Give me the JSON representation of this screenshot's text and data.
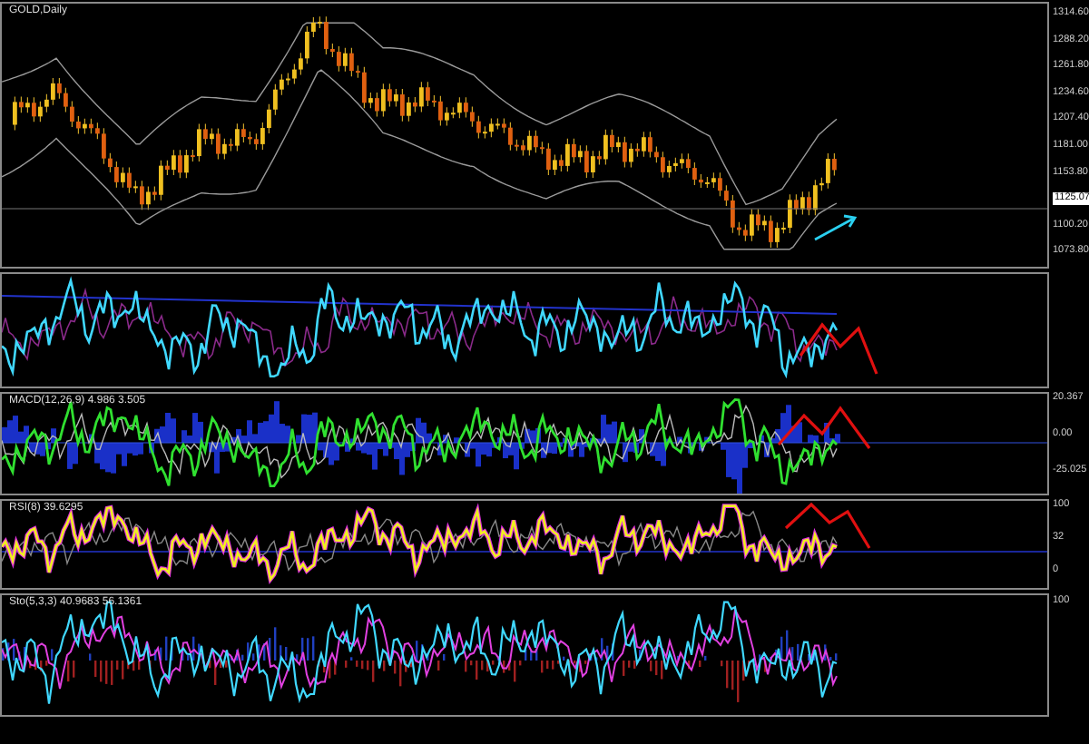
{
  "chart": {
    "title": "GOLD,Daily",
    "price_labels": [
      {
        "text": "1314.60",
        "current": false
      },
      {
        "text": "1288.20",
        "current": false
      },
      {
        "text": "1261.80",
        "current": false
      },
      {
        "text": "1234.60",
        "current": false
      },
      {
        "text": "1207.40",
        "current": false
      },
      {
        "text": "1181.00",
        "current": false
      },
      {
        "text": "1153.80",
        "current": false
      },
      {
        "text": "1125.07",
        "current": true
      },
      {
        "text": "1100.20",
        "current": false
      },
      {
        "text": "1073.80",
        "current": false
      }
    ]
  },
  "panels": [
    {
      "kind": "cci"
    },
    {
      "kind": "macd",
      "label": "MACD(12,26,9) 4.986 3.505",
      "axis_labels": [
        "20.367",
        "0.00",
        "-25.025"
      ]
    },
    {
      "kind": "rsi",
      "label": "RSI(8) 39.6295",
      "axis_labels": [
        "100",
        "32",
        "0"
      ]
    },
    {
      "kind": "stoch",
      "label": "Sto(5,3,3) 40.9683 56.1361",
      "axis_labels": [
        "100"
      ]
    }
  ]
}
